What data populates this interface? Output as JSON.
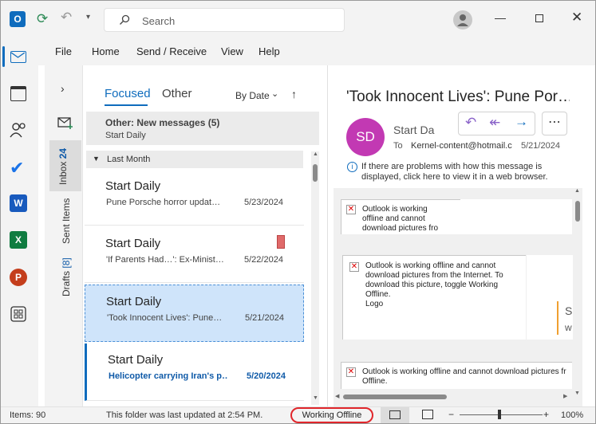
{
  "titlebar": {
    "search_placeholder": "Search"
  },
  "menu": {
    "items": [
      "File",
      "Home",
      "Send / Receive",
      "View",
      "Help"
    ]
  },
  "folders": {
    "inbox_label": "Inbox",
    "inbox_count": "24",
    "sent_label": "Sent Items",
    "drafts_label": "Drafts",
    "drafts_count": "[8]"
  },
  "list": {
    "tab_focused": "Focused",
    "tab_other": "Other",
    "sort_label": "By Date",
    "notif_title": "Other: New messages (5)",
    "notif_sub": "Start Daily",
    "section": "Last Month",
    "messages": [
      {
        "sender": "Start Daily",
        "subject": "Pune Porsche horror updat…",
        "date": "5/23/2024"
      },
      {
        "sender": "Start Daily",
        "subject": "'If Parents Had…': Ex-Minist…",
        "date": "5/22/2024"
      },
      {
        "sender": "Start Daily",
        "subject": "'Took Innocent Lives': Pune…",
        "date": "5/21/2024"
      },
      {
        "sender": "Start Daily",
        "subject": "Helicopter carrying Iran's p…",
        "date": "5/20/2024"
      }
    ]
  },
  "reading": {
    "title": "'Took Innocent Lives': Pune Por…",
    "avatar_initials": "SD",
    "sender": "Start Da",
    "to_label": "To",
    "to_address": "Kernel-content@hotmail.c",
    "date": "5/21/2024",
    "info_line1": "If there are problems with how this message is",
    "info_line2": "displayed, click here to view it in a web browser.",
    "img1": [
      "Outlook is working",
      "offline and cannot",
      "download pictures fro"
    ],
    "img2": [
      "Outlook is working offline and cannot",
      "download pictures from the Internet. To",
      "download this picture, toggle Working",
      "Offline.",
      "Logo"
    ],
    "img3": [
      "Outlook is working offline and cannot download pictures fr",
      "Offline."
    ],
    "side_s": "S",
    "side_w": "w"
  },
  "status": {
    "items": "Items: 90",
    "updated": "This folder was last updated at 2:54 PM.",
    "offline": "Working Offline",
    "zoom": "100%"
  },
  "colors": {
    "accent": "#0f6cbd",
    "avatar": "#c239b3",
    "offline_ring": "#e0262b",
    "selected_bg": "#cfe4fa"
  }
}
